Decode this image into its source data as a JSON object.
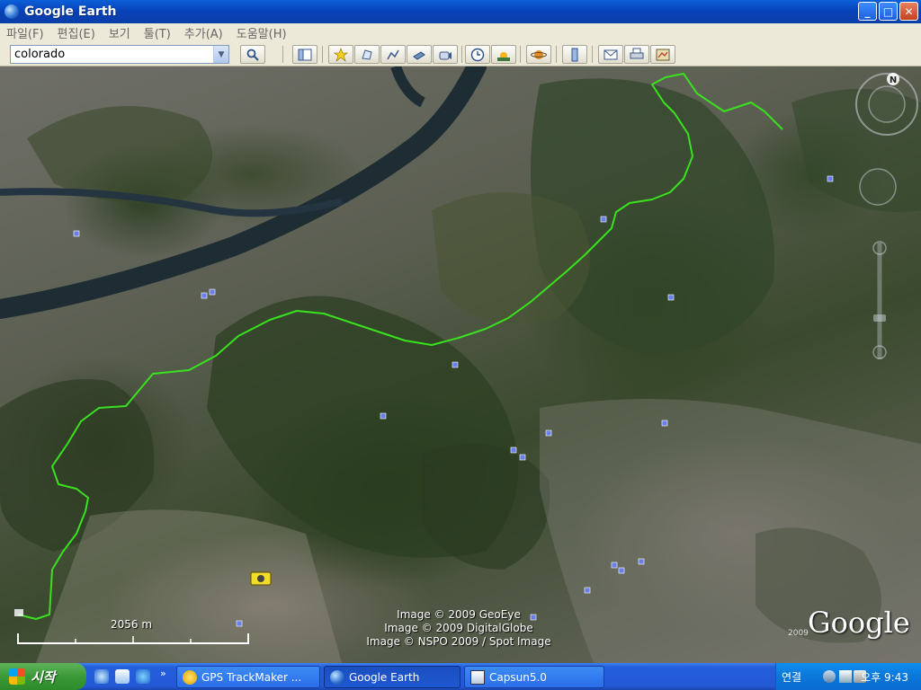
{
  "window": {
    "title": "Google Earth"
  },
  "window_buttons": {
    "minimize": "_",
    "maximize": "□",
    "close": "✕"
  },
  "menu": [
    {
      "label": "파일(F)"
    },
    {
      "label": "편집(E)"
    },
    {
      "label": "보기"
    },
    {
      "label": "툴(T)"
    },
    {
      "label": "추가(A)"
    },
    {
      "label": "도움말(H)"
    }
  ],
  "search": {
    "value": "colorado",
    "button_icon": "magnifier-icon"
  },
  "toolbar_icons": [
    "sidebar-toggle-icon",
    "placemark-icon",
    "polygon-icon",
    "path-icon",
    "image-overlay-icon",
    "record-tour-icon",
    "historical-imagery-icon",
    "sunlight-icon",
    "planets-icon",
    "ruler-icon",
    "email-icon",
    "print-icon",
    "view-in-maps-icon"
  ],
  "map": {
    "scale_label": "2056 m",
    "credits": [
      "Image © 2009 GeoEye",
      "Image © 2009 DigitalGlobe",
      "Image © NSPO 2009 / Spot Image"
    ],
    "brand": "Google",
    "brand_year": "2009",
    "compass_north": "N",
    "track_color": "#39e11e",
    "river_color": "#1e2c34"
  },
  "taskbar": {
    "start_label": "시작",
    "quicklaunch_more": "»",
    "tasks": [
      {
        "label": "GPS TrackMaker ...",
        "icon": "gps-trackmaker-icon",
        "active": false
      },
      {
        "label": "Google Earth",
        "icon": "google-earth-icon",
        "active": true
      },
      {
        "label": "Capsun5.0",
        "icon": "capsun-icon",
        "active": false
      }
    ],
    "tray": {
      "language": "연결",
      "clock": "오후 9:43"
    }
  }
}
